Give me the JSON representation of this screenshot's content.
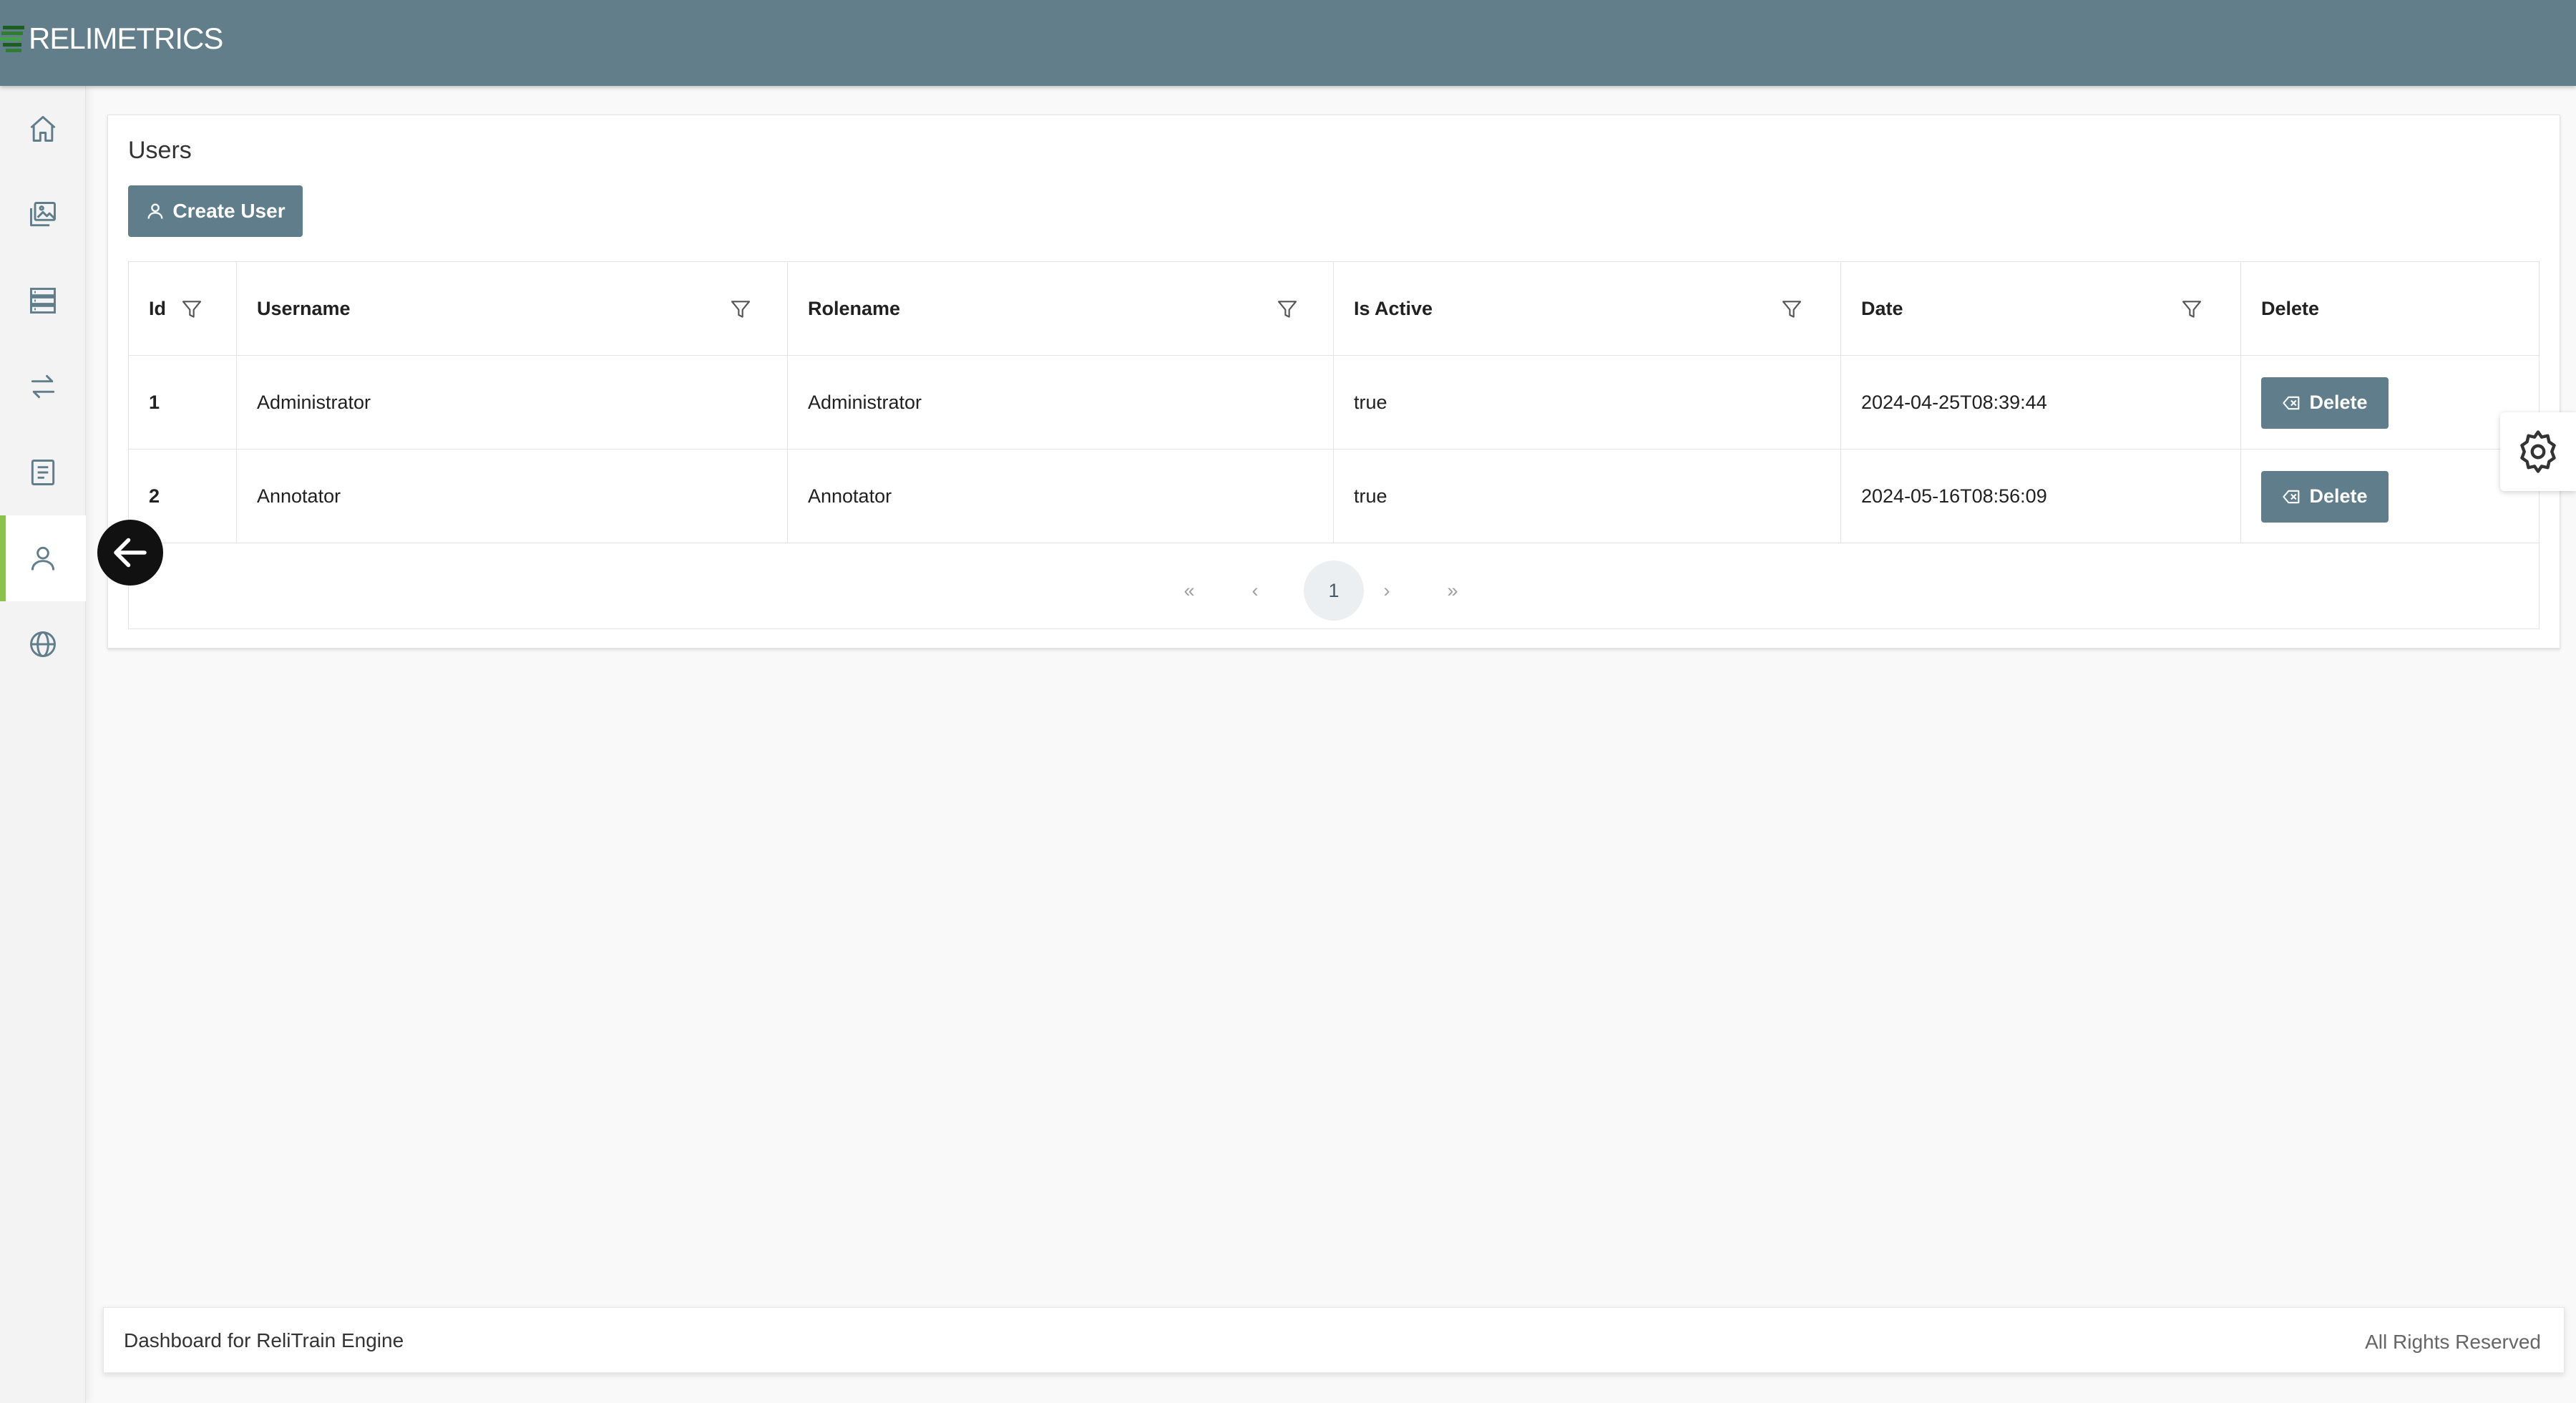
{
  "app": {
    "brand": "RELIMETRICS",
    "brand_colors": {
      "topbar": "#637e8b",
      "accent": "#8bc34a",
      "button": "#607d8b"
    }
  },
  "sidebar": {
    "items": [
      {
        "icon": "home-icon",
        "active": false
      },
      {
        "icon": "images-icon",
        "active": false
      },
      {
        "icon": "datasets-icon",
        "active": false
      },
      {
        "icon": "transfer-icon",
        "active": false
      },
      {
        "icon": "document-icon",
        "active": false
      },
      {
        "icon": "user-icon",
        "active": true
      },
      {
        "icon": "globe-icon",
        "active": false
      }
    ]
  },
  "page": {
    "title": "Users",
    "create_button_label": "Create User"
  },
  "table": {
    "columns": [
      "Id",
      "Username",
      "Rolename",
      "Is Active",
      "Date",
      "Delete"
    ],
    "rows": [
      {
        "id": "1",
        "username": "Administrator",
        "rolename": "Administrator",
        "is_active": "true",
        "date": "2024-04-25T08:39:44",
        "delete_label": "Delete"
      },
      {
        "id": "2",
        "username": "Annotator",
        "rolename": "Annotator",
        "is_active": "true",
        "date": "2024-05-16T08:56:09",
        "delete_label": "Delete"
      }
    ]
  },
  "pagination": {
    "first": "«",
    "prev": "‹",
    "current": "1",
    "next": "›",
    "last": "»"
  },
  "footer": {
    "left": "Dashboard for ReliTrain Engine",
    "right": "All Rights Reserved"
  }
}
